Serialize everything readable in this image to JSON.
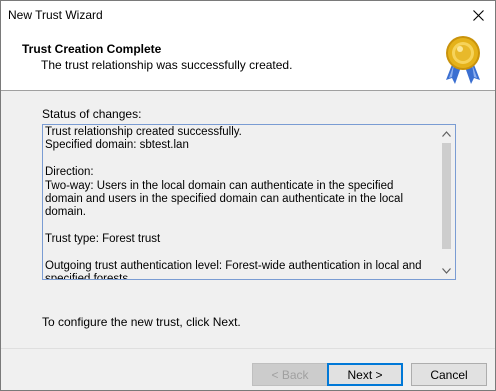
{
  "window": {
    "title": "New Trust Wizard"
  },
  "header": {
    "title": "Trust Creation Complete",
    "subtitle": "The trust relationship was successfully created.",
    "icon": "award-medal-icon"
  },
  "status": {
    "label": "Status of changes:",
    "text": "Trust relationship created successfully.\nSpecified domain: sbtest.lan\n\nDirection:\nTwo-way: Users in the local domain can authenticate in the specified domain and users in the specified domain can authenticate in the local domain.\n\nTrust type: Forest trust\n\nOutgoing trust authentication level: Forest-wide authentication in local and specified forests."
  },
  "footer": {
    "instruction": "To configure the new trust, click Next."
  },
  "buttons": {
    "back": "< Back",
    "next": "Next >",
    "cancel": "Cancel"
  },
  "colors": {
    "accent": "#0078d7",
    "dialog_bg": "#f0f0f0",
    "header_bg": "#ffffff",
    "medal_gold": "#e5b21a",
    "ribbon_blue": "#3b6fd1"
  }
}
